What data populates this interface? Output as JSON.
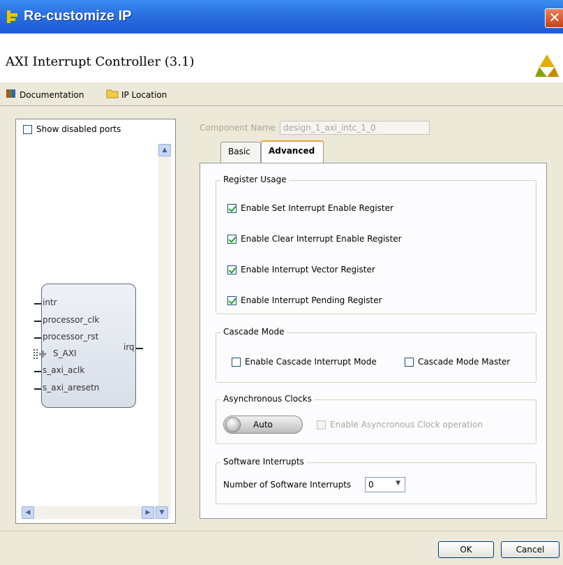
{
  "window": {
    "title": "Re-customize IP",
    "close_label": "✕"
  },
  "header": {
    "title": "AXI Interrupt Controller (3.1)"
  },
  "toolbar": {
    "documentation": "Documentation",
    "ip_location": "IP Location"
  },
  "left": {
    "show_disabled_ports": "Show disabled ports",
    "ports_left": [
      "intr",
      "processor_clk",
      "processor_rst",
      "S_AXI",
      "s_axi_aclk",
      "s_axi_aresetn"
    ],
    "port_right": "irq"
  },
  "component": {
    "label": "Component Name",
    "value": "design_1_axi_intc_1_0"
  },
  "tabs": {
    "basic": "Basic",
    "advanced": "Advanced"
  },
  "register_usage": {
    "title": "Register Usage",
    "items": [
      "Enable Set Interrupt Enable Register",
      "Enable Clear Interrupt Enable Register",
      "Enable Interrupt Vector Register",
      "Enable Interrupt Pending Register"
    ]
  },
  "cascade": {
    "title": "Cascade Mode",
    "enable": "Enable Cascade Interrupt Mode",
    "master": "Cascade Mode Master"
  },
  "async": {
    "title": "Asynchronous Clocks",
    "auto": "Auto",
    "enable": "Enable Asyncronous Clock operation"
  },
  "software": {
    "title": "Software Interrupts",
    "label": "Number of Software Interrupts",
    "value": "0"
  },
  "buttons": {
    "ok": "OK",
    "cancel": "Cancel"
  },
  "colors": {
    "titlebar": "#2a6fe0",
    "tab_accent": "#e8a33c"
  }
}
